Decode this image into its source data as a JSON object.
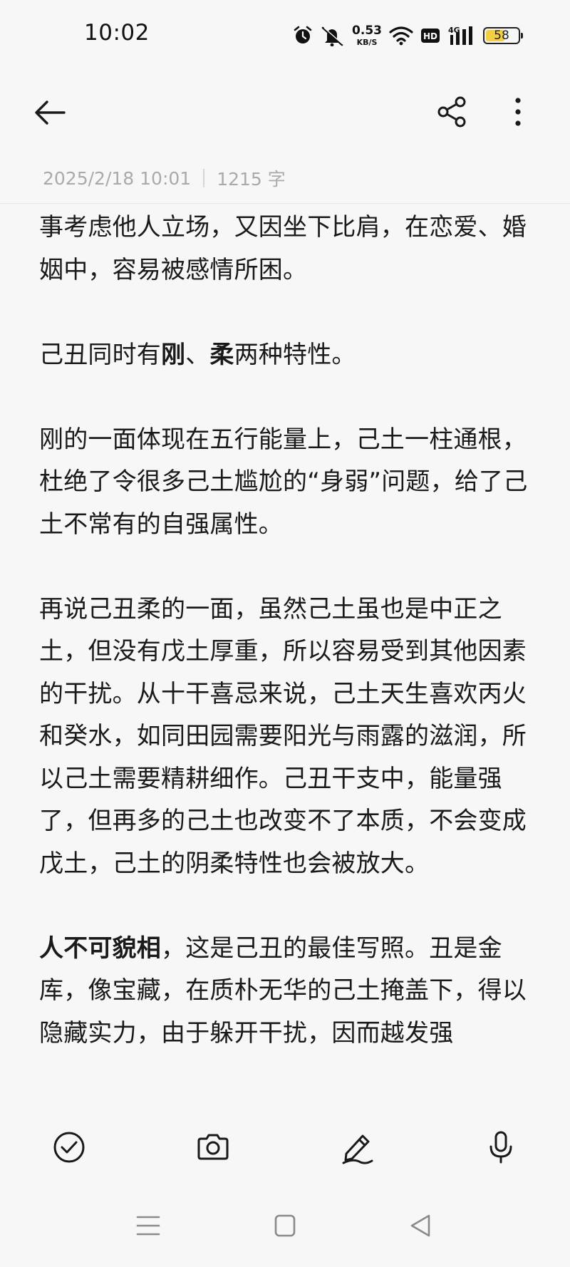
{
  "status_bar": {
    "time": "10:02",
    "net_speed_value": "0.53",
    "net_speed_unit": "KB/S",
    "hd_label": "HD",
    "network_label": "4G",
    "battery_level": "58",
    "battery_fraction": 0.58,
    "battery_color": "#f2cf45"
  },
  "toolbar": {
    "back_icon": "arrow-left-icon",
    "share_icon": "share-icon",
    "more_icon": "more-vertical-icon"
  },
  "note_meta": {
    "datetime": "2025/2/18 10:01",
    "word_count": "1215 字"
  },
  "note_body": {
    "p1": "事考虑他人立场，又因坐下比肩，在恋爱、婚姻中，容易被感情所困。",
    "p2_a": "己丑同时有",
    "p2_bold1": "刚",
    "p2_b": "、",
    "p2_bold2": "柔",
    "p2_c": "两种特性。",
    "p3": "刚的一面体现在五行能量上，己土一柱通根，杜绝了令很多己土尴尬的“身弱”问题，给了己土不常有的自强属性。",
    "p4": "再说己丑柔的一面，虽然己土虽也是中正之土，但没有戊土厚重，所以容易受到其他因素的干扰。从十干喜忌来说，己土天生喜欢丙火和癸水，如同田园需要阳光与雨露的滋润，所以己土需要精耕细作。己丑干支中，能量强了，但再多的己土也改变不了本质，不会变成戊土，己土的阴柔特性也会被放大。",
    "p5_bold": "人不可貌相",
    "p5_rest": "，这是己丑的最佳写照。丑是金库，像宝藏，在质朴无华的己土掩盖下，得以隐藏实力，由于躲开干扰，因而越发强"
  },
  "bottom_tools": {
    "checklist_icon": "check-circle-icon",
    "camera_icon": "camera-icon",
    "pen_icon": "pen-icon",
    "mic_icon": "microphone-icon"
  },
  "nav_bar": {
    "menu_icon": "menu-icon",
    "home_icon": "home-square-icon",
    "back_icon": "back-triangle-icon"
  }
}
